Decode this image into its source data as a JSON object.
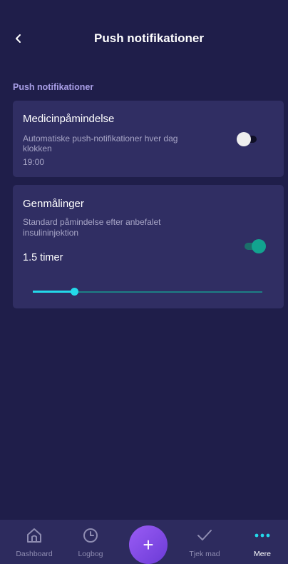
{
  "header": {
    "title": "Push notifikationer",
    "back_icon": "chevron-left-icon"
  },
  "section": {
    "title": "Push notifikationer"
  },
  "cards": {
    "medicine": {
      "title": "Medicinpåmindelse",
      "desc_line1": "Automatiske push-notifikationer hver dag",
      "desc_line2": "klokken",
      "desc_line3": "19:00",
      "toggle_on": false
    },
    "remeasure": {
      "title": "Genmålinger",
      "desc_line1": "Standard påmindelse efter anbefalet",
      "desc_line2": "insulininjektion",
      "value_label": "1.5 timer",
      "toggle_on": true,
      "slider_fraction": 0.18
    }
  },
  "colors": {
    "background": "#1f1e4a",
    "card": "#302e63",
    "accent_cyan": "#23d9ea",
    "toggle_on": "#12a38f",
    "section_title": "#a89ee6",
    "fab_gradient_start": "#9a5cf5",
    "fab_gradient_end": "#6b3bd6"
  },
  "bottom_nav": {
    "dashboard": {
      "label": "Dashboard",
      "icon": "home-icon"
    },
    "logbog": {
      "label": "Logbog",
      "icon": "clock-icon"
    },
    "add": {
      "label": "+",
      "icon": "plus-icon"
    },
    "tjek_mad": {
      "label": "Tjek mad",
      "icon": "checkmark-icon"
    },
    "mere": {
      "label": "Mere",
      "icon": "more-dots-icon",
      "active": true
    }
  }
}
